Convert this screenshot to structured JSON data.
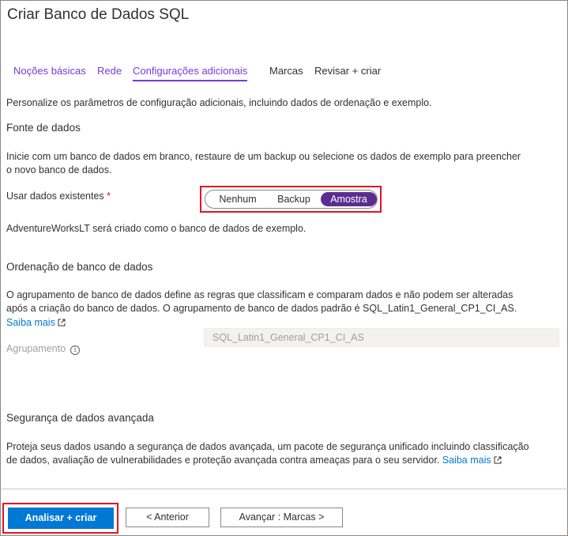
{
  "header": {
    "title": "Criar Banco de Dados SQL"
  },
  "tabs": [
    {
      "label": "Noções básicas"
    },
    {
      "label": "Rede"
    },
    {
      "label": "Configurações adicionais"
    },
    {
      "label": "Marcas"
    },
    {
      "label": "Revisar + criar"
    }
  ],
  "intro": "Personalize os parâmetros de configuração adicionais, incluindo dados de ordenação e exemplo.",
  "datasource": {
    "heading": "Fonte de dados",
    "desc_line1": "Inicie com um banco de dados em branco, restaure de um backup ou selecione os dados de exemplo para preencher",
    "desc_line2": "o novo banco de dados.",
    "field_label": "Usar dados existentes",
    "required_mark": "*",
    "options": [
      "Nenhum",
      "Backup",
      "Amostra"
    ],
    "selected": "Amostra",
    "note": "AdventureWorksLT será criado como o banco de dados de exemplo."
  },
  "collation": {
    "heading": "Ordenação de banco de dados",
    "desc_line1": "O agrupamento de banco de dados define as regras que classificam e comparam dados e não podem ser alteradas",
    "desc_line2": "após a criação do banco de dados. O agrupamento de banco de dados padrão é SQL_Latin1_General_CP1_CI_AS.",
    "learn_more": "Saiba mais",
    "field_label": "Agrupamento",
    "value": "SQL_Latin1_General_CP1_CI_AS"
  },
  "security": {
    "heading": "Segurança de dados avançada",
    "desc_line1": "Proteja seus dados usando a segurança de dados avançada, um pacote de segurança unificado incluindo classificação",
    "desc_line2": "de dados, avaliação de vulnerabilidades e proteção avançada contra ameaças para o seu servidor.",
    "learn_more": "Saiba mais"
  },
  "footer": {
    "primary": "Analisar + criar",
    "previous": "< Anterior",
    "next": "Avançar : Marcas >"
  },
  "colors": {
    "accent": "#773adc",
    "toggle_selected": "#5c2d91",
    "primary_button": "#0078d4",
    "highlight": "#e81123"
  }
}
